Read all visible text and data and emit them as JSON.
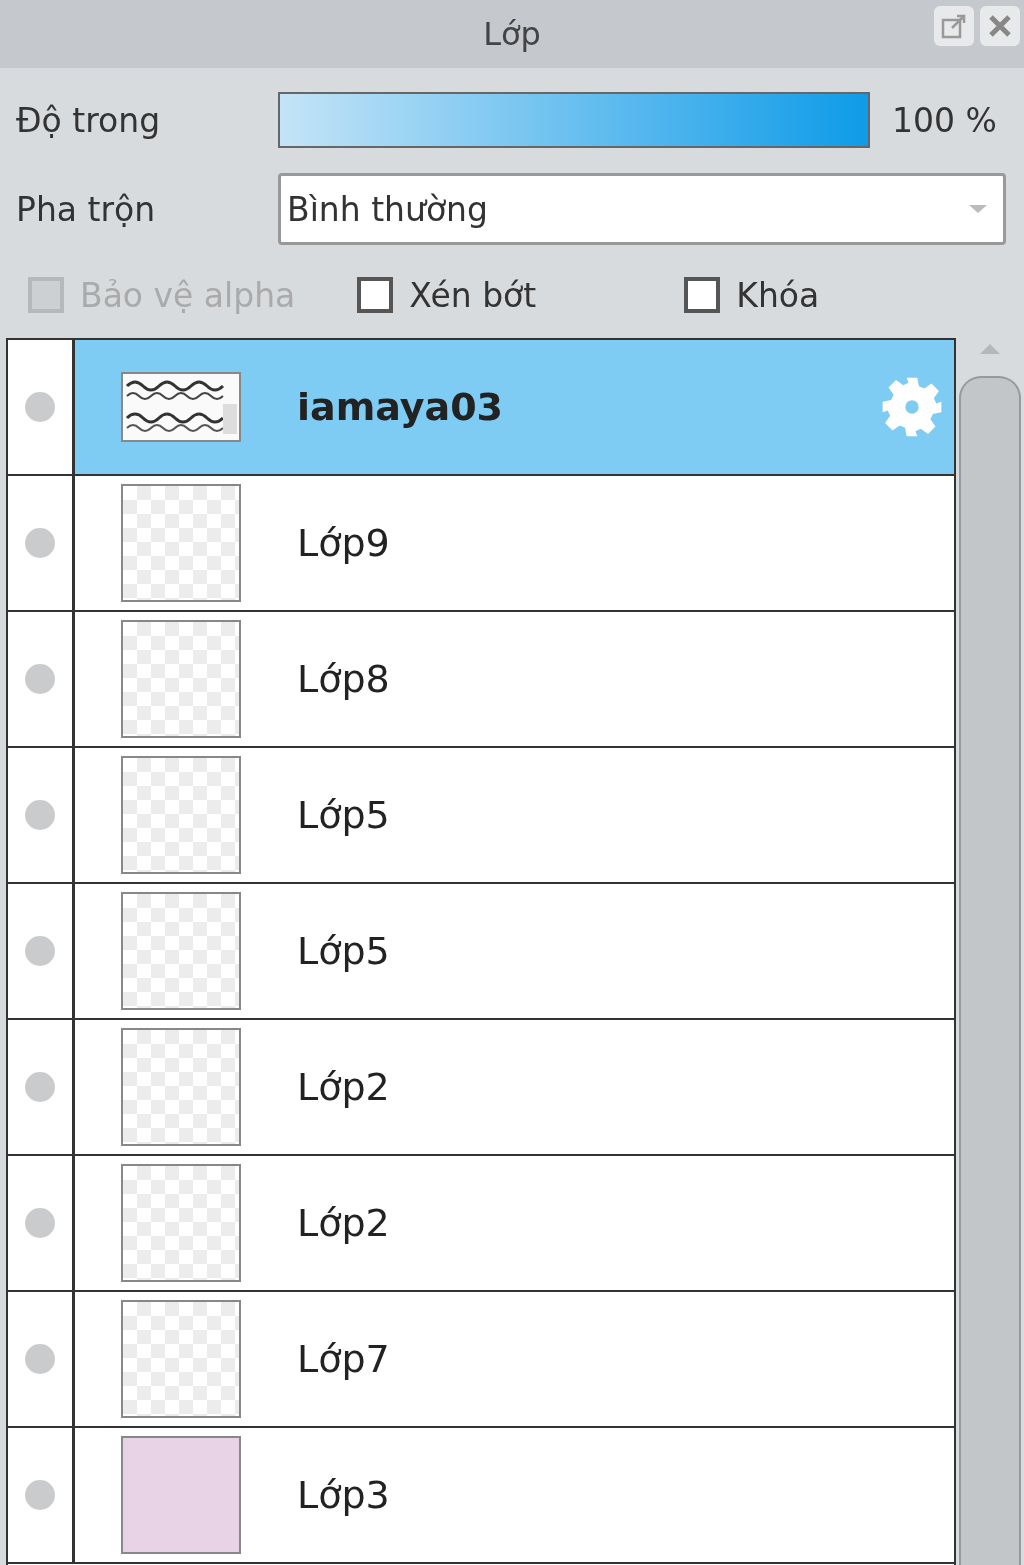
{
  "panel": {
    "title": "Lớp"
  },
  "opacity": {
    "label": "Độ trong",
    "level": 1,
    "reading": "100 %"
  },
  "blend": {
    "label": "Pha trộn",
    "value": "Bình thường"
  },
  "options": [
    {
      "label": "Bảo vệ alpha",
      "checked": false,
      "disabled": true
    },
    {
      "label": "Xén bớt",
      "checked": false,
      "disabled": false
    },
    {
      "label": "Khóa",
      "checked": false,
      "disabled": false
    }
  ],
  "layers": [
    {
      "name": "iamaya03",
      "selected": true,
      "kind": "picture"
    },
    {
      "name": "Lớp9",
      "selected": false,
      "kind": "transparent"
    },
    {
      "name": "Lớp8",
      "selected": false,
      "kind": "transparent"
    },
    {
      "name": "Lớp5",
      "selected": false,
      "kind": "transparent"
    },
    {
      "name": "Lớp5",
      "selected": false,
      "kind": "transparent"
    },
    {
      "name": "Lớp2",
      "selected": false,
      "kind": "transparent"
    },
    {
      "name": "Lớp2",
      "selected": false,
      "kind": "transparent"
    },
    {
      "name": "Lớp7",
      "selected": false,
      "kind": "transparent"
    },
    {
      "name": "Lớp3",
      "selected": false,
      "kind": "solid",
      "color": "#e8d3e6"
    }
  ]
}
